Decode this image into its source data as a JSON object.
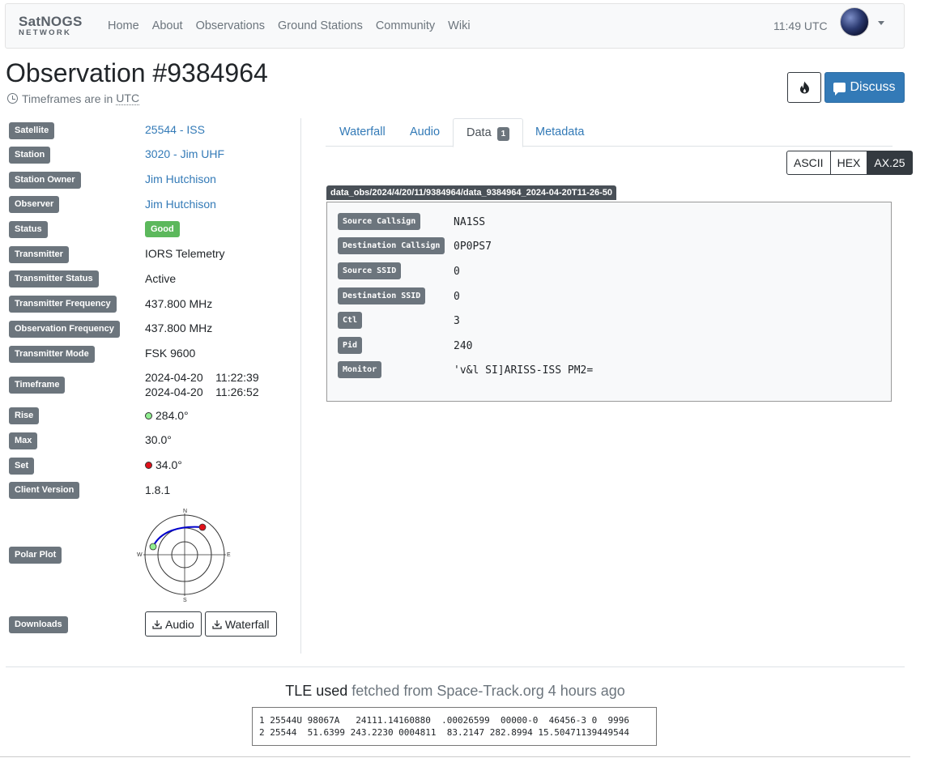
{
  "navbar": {
    "logo_line1": "SatNOGS",
    "logo_line2": "NETWORK",
    "links": [
      "Home",
      "About",
      "Observations",
      "Ground Stations",
      "Community",
      "Wiki"
    ],
    "time": "11:49 UTC"
  },
  "header": {
    "title": "Observation #9384964",
    "tz_prefix": "Timeframes are in",
    "tz_value": "UTC",
    "discuss_label": "Discuss"
  },
  "info": [
    {
      "label": "Satellite",
      "value": "25544 - ISS",
      "link": true
    },
    {
      "label": "Station",
      "value": "3020 - Jim UHF",
      "link": true
    },
    {
      "label": "Station Owner",
      "value": "Jim Hutchison",
      "link": true
    },
    {
      "label": "Observer",
      "value": "Jim Hutchison",
      "link": true
    },
    {
      "label": "Status",
      "value": "Good"
    },
    {
      "label": "Transmitter",
      "value": "IORS Telemetry"
    },
    {
      "label": "Transmitter Status",
      "value": "Active"
    },
    {
      "label": "Transmitter Frequency",
      "value": "437.800 MHz"
    },
    {
      "label": "Observation Frequency",
      "value": "437.800 MHz"
    },
    {
      "label": "Transmitter Mode",
      "value": "FSK 9600"
    },
    {
      "label": "Timeframe",
      "start": "2024-04-20    11:22:39",
      "end": "2024-04-20    11:26:52"
    },
    {
      "label": "Rise",
      "value": "284.0°"
    },
    {
      "label": "Max",
      "value": "30.0°"
    },
    {
      "label": "Set",
      "value": "34.0°"
    },
    {
      "label": "Client Version",
      "value": "1.8.1"
    },
    {
      "label": "Polar Plot"
    },
    {
      "label": "Downloads",
      "audio": "Audio",
      "waterfall": "Waterfall"
    }
  ],
  "polar": {
    "n": "N",
    "e": "E",
    "s": "S",
    "w": "W",
    "rise_color": "#90ee90",
    "set_color": "#e0101a",
    "track_color": "#0000cc"
  },
  "tabs": [
    {
      "label": "Waterfall"
    },
    {
      "label": "Audio"
    },
    {
      "label": "Data",
      "count": "1",
      "active": true
    },
    {
      "label": "Metadata"
    }
  ],
  "formats": [
    "ASCII",
    "HEX",
    "AX.25"
  ],
  "active_format": "AX.25",
  "data_file": "data_obs/2024/4/20/11/9384964/data_9384964_2024-04-20T11-26-50",
  "frame_fields": [
    {
      "label": "Source Callsign",
      "value": "NA1SS"
    },
    {
      "label": "Destination Callsign",
      "value": "0P0PS7"
    },
    {
      "label": "Source SSID",
      "value": "0"
    },
    {
      "label": "Destination SSID",
      "value": "0"
    },
    {
      "label": "Ctl",
      "value": "3"
    },
    {
      "label": "Pid",
      "value": "240"
    },
    {
      "label": "Monitor",
      "value": "'v&l SI]ARISS-ISS PM2="
    }
  ],
  "tle": {
    "title": "TLE used",
    "source": "fetched from Space-Track.org 4 hours ago",
    "line1": "1 25544U 98067A   24111.14160880  .00026599  00000-0  46456-3 0  9996",
    "line2": "2 25544  51.6399 243.2230 0004811  83.2147 282.8994 15.50471139449544"
  },
  "colors": {
    "accent": "#337ab7",
    "label_bg": "#6c757d",
    "good": "#5cb85c"
  }
}
